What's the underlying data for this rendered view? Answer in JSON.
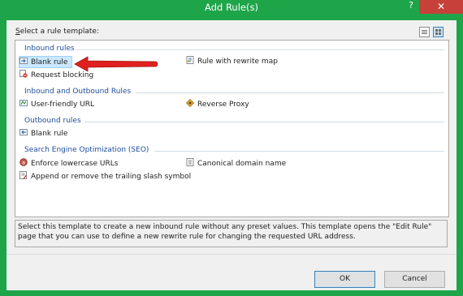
{
  "window": {
    "title": "Add Rule(s)",
    "help_glyph": "?",
    "close_glyph": "✕"
  },
  "prompt": {
    "accel": "S",
    "rest": "elect a rule template:"
  },
  "groups": [
    {
      "label": "Inbound rules"
    },
    {
      "label": "Inbound and Outbound Rules"
    },
    {
      "label": "Outbound rules"
    },
    {
      "label": "Search Engine Optimization (SEO)"
    }
  ],
  "items": {
    "inbound_blank": {
      "label": "Blank rule",
      "icon": "blank-rule-icon",
      "selected": true
    },
    "rewrite_map": {
      "label": "Rule with rewrite map",
      "icon": "rewrite-map-icon"
    },
    "request_blocking": {
      "label": "Request blocking",
      "icon": "request-blocking-icon"
    },
    "user_friendly_url": {
      "label": "User-friendly URL",
      "icon": "user-friendly-url-icon"
    },
    "reverse_proxy": {
      "label": "Reverse Proxy",
      "icon": "reverse-proxy-icon"
    },
    "outbound_blank": {
      "label": "Blank rule",
      "icon": "blank-rule-icon"
    },
    "lowercase": {
      "label": "Enforce lowercase URLs",
      "icon": "lowercase-icon"
    },
    "canonical": {
      "label": "Canonical domain name",
      "icon": "canonical-domain-icon"
    },
    "trailing_slash": {
      "label": "Append or remove the trailing slash symbol",
      "icon": "trailing-slash-icon"
    }
  },
  "description": "Select this template to create a new inbound rule without any preset values. This template opens the \"Edit Rule\" page that you can use to define a new rewrite rule for changing the requested URL address.",
  "buttons": {
    "ok": "OK",
    "cancel": "Cancel"
  },
  "colors": {
    "window_frame": "#1ea54a",
    "close_button": "#c6413a",
    "group_label": "#1f4e9d",
    "selection": "#cce8ff",
    "annotation_arrow": "#e02020"
  }
}
